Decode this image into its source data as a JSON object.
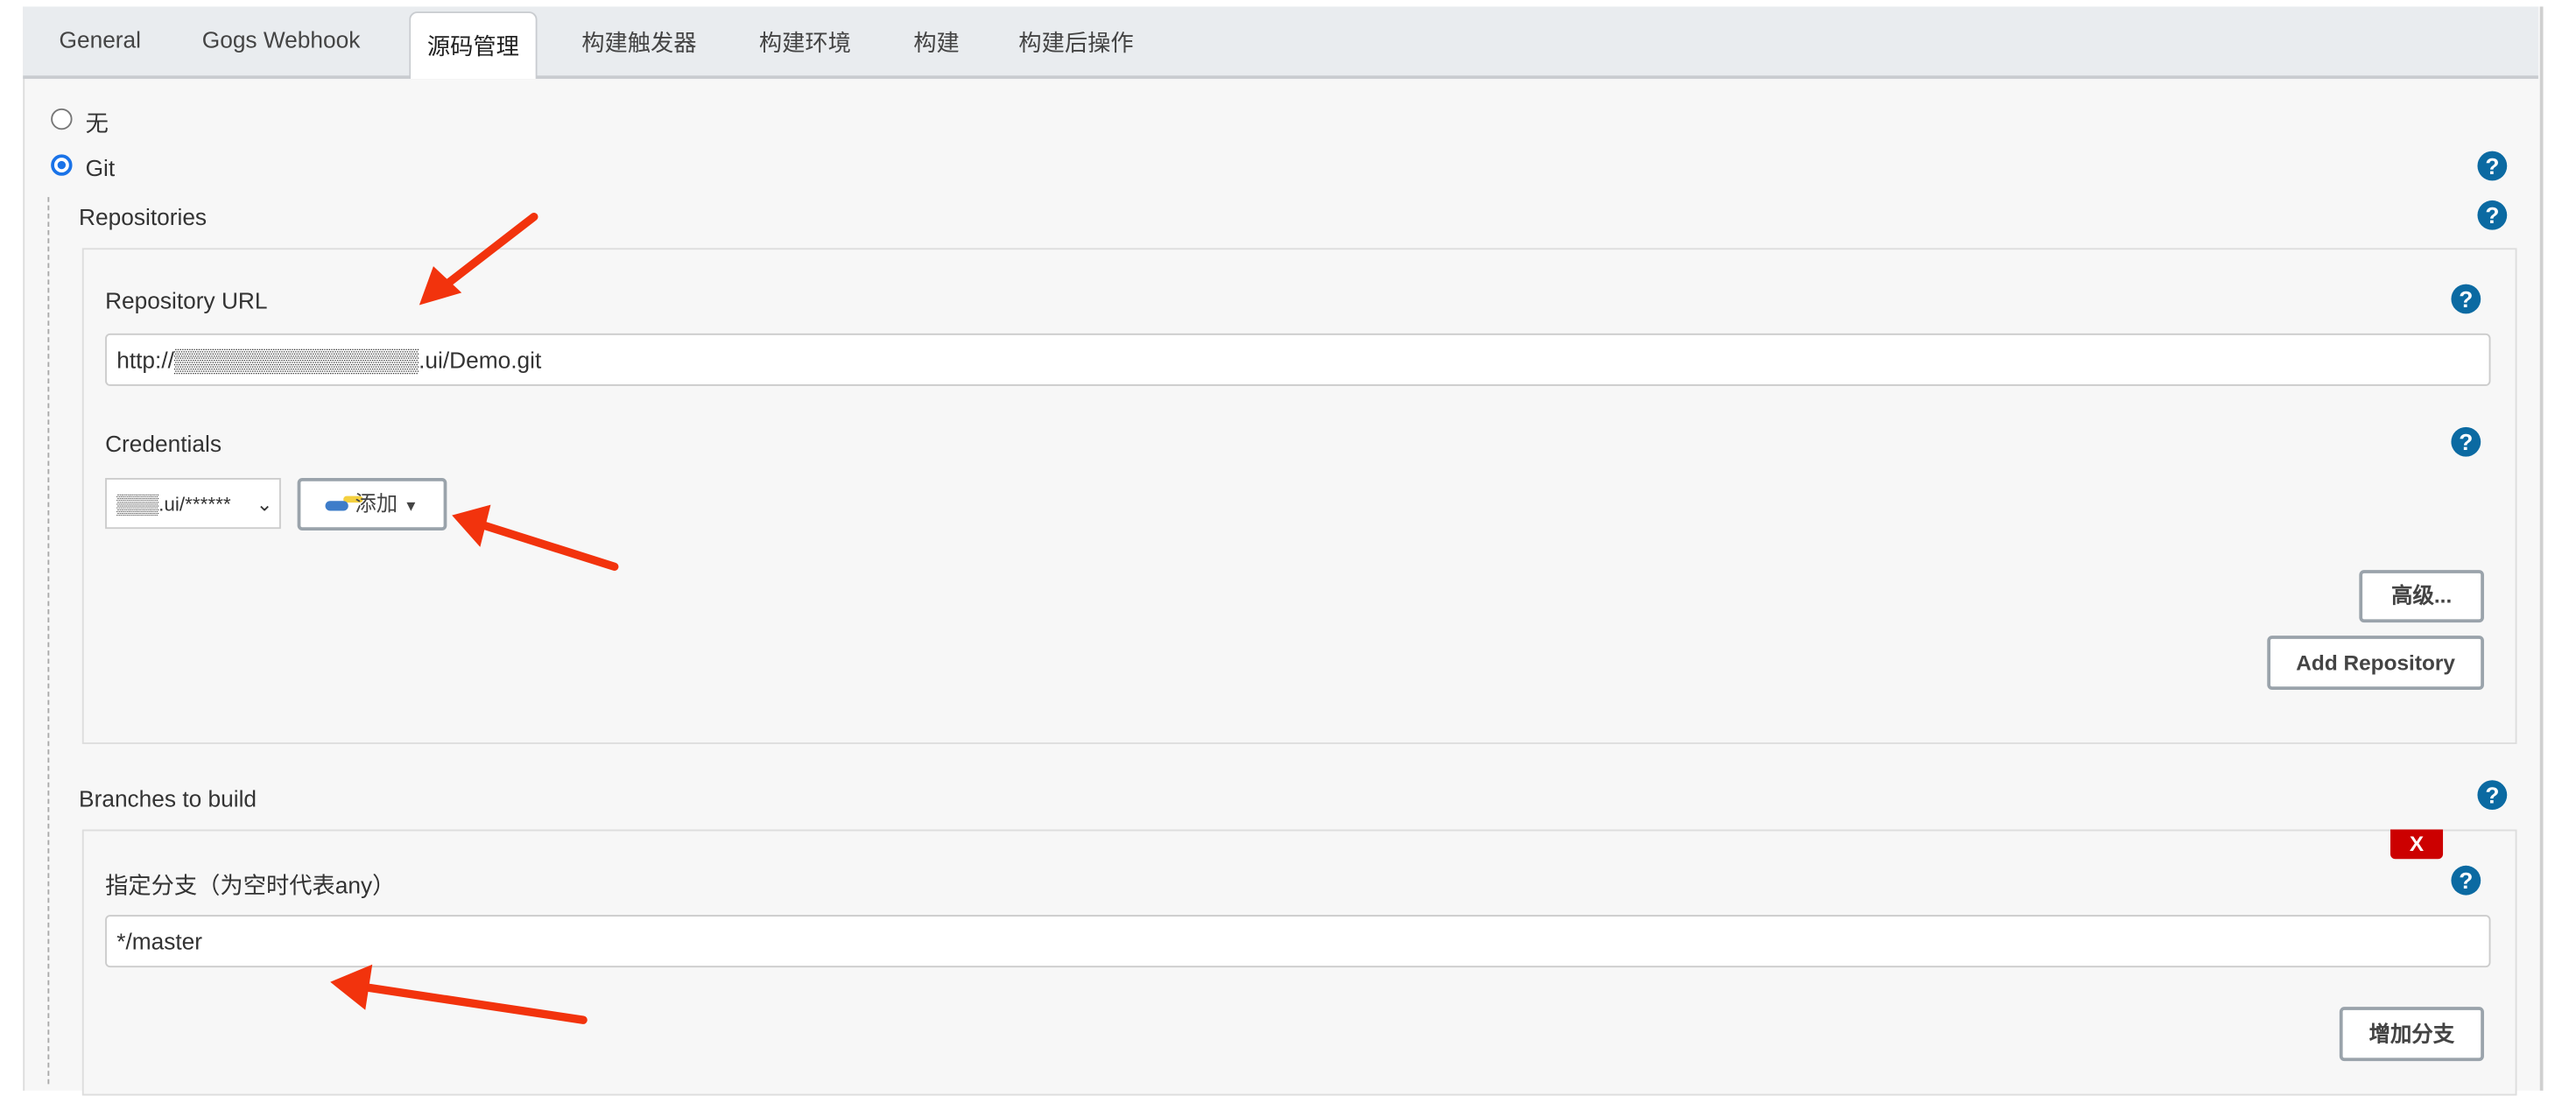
{
  "tabs": [
    {
      "label": "General"
    },
    {
      "label": "Gogs Webhook"
    },
    {
      "label": "源码管理",
      "active": true
    },
    {
      "label": "构建触发器"
    },
    {
      "label": "构建环境"
    },
    {
      "label": "构建"
    },
    {
      "label": "构建后操作"
    }
  ],
  "scm": {
    "options": [
      {
        "label": "无",
        "checked": false
      },
      {
        "label": "Git",
        "checked": true
      }
    ],
    "help": "?"
  },
  "repositories": {
    "title": "Repositories",
    "url_label": "Repository URL",
    "url_value": "http://▒▒▒▒▒▒▒▒▒▒▒▒▒▒▒.ui/Demo.git",
    "credentials_label": "Credentials",
    "credentials_value": "▒▒▒.ui/******",
    "add_label": "添加",
    "advanced_label": "高级...",
    "add_repository_label": "Add Repository"
  },
  "branches": {
    "title": "Branches to build",
    "delete_label": "X",
    "spec_label": "指定分支（为空时代表any）",
    "spec_value": "*/master",
    "add_branch_label": "增加分支"
  },
  "colors": {
    "accent": "#0b6aa2",
    "delete": "#cc0000",
    "annotation": "#f2330d"
  }
}
